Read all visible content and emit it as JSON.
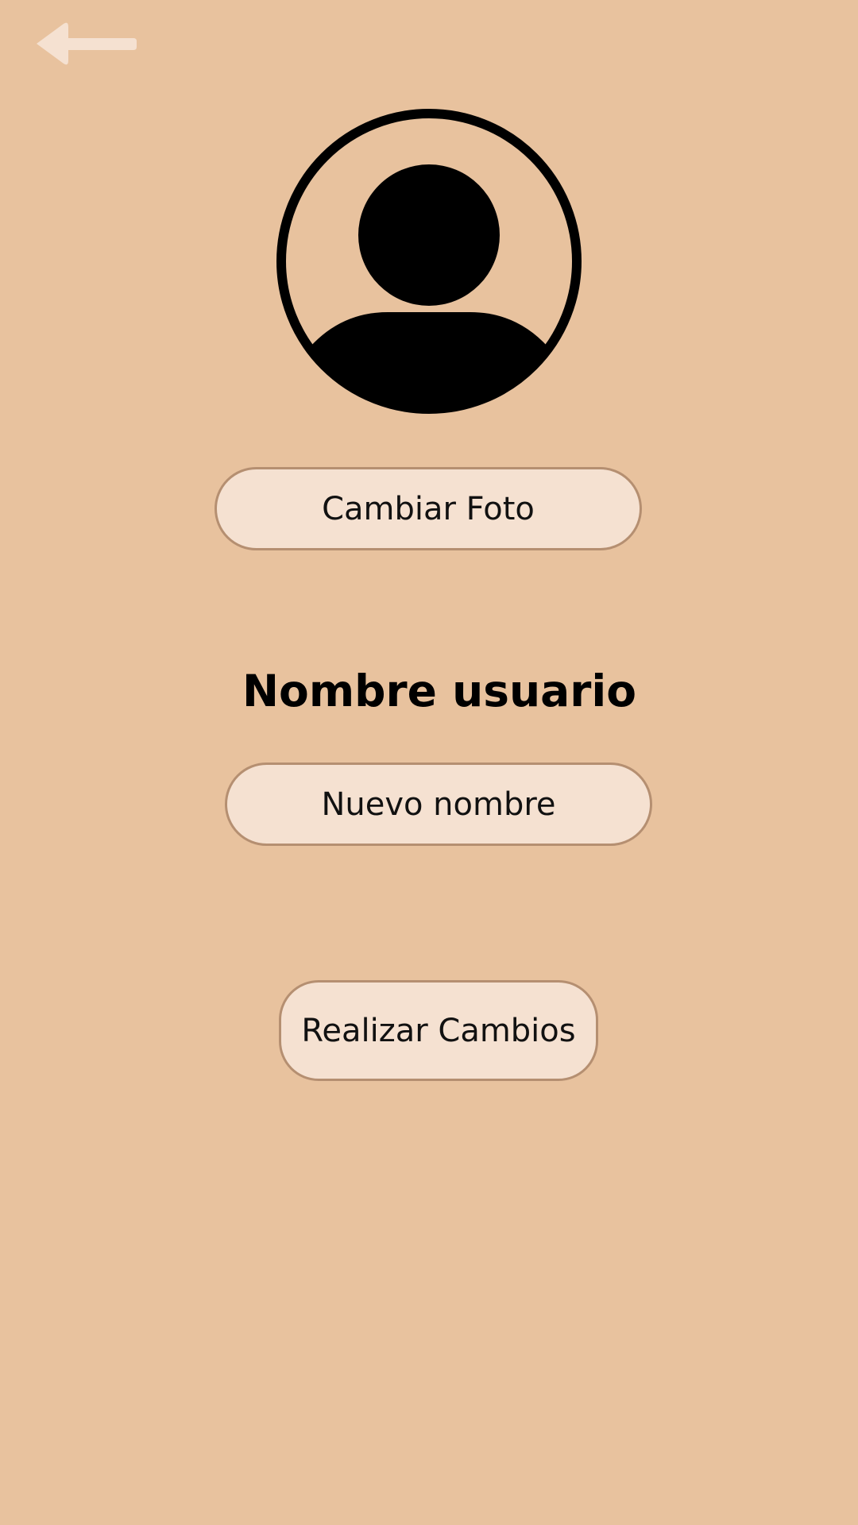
{
  "header": {
    "back_icon": "arrow-left-icon"
  },
  "profile": {
    "avatar_icon": "user-avatar-icon",
    "change_photo_label": "Cambiar Foto",
    "username": "Nombre usuario"
  },
  "form": {
    "name_placeholder": "Nuevo nombre",
    "name_value": "",
    "submit_label": "Realizar Cambios"
  },
  "colors": {
    "background": "#e8c29e",
    "button_fill": "#f5e1d1",
    "button_border": "#b58f71",
    "back_arrow": "#f5e1d1",
    "avatar": "#000000"
  }
}
